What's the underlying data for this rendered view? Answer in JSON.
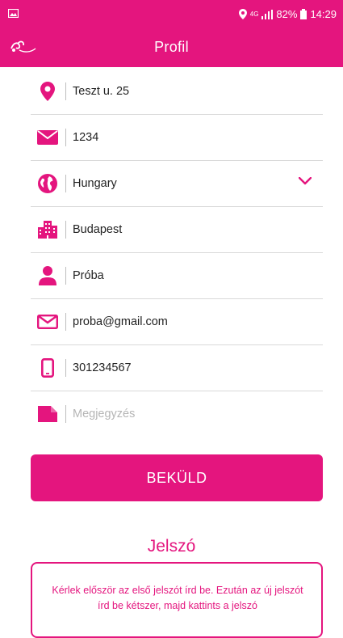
{
  "status_bar": {
    "network": "4G",
    "battery": "82%",
    "time": "14:29"
  },
  "app_bar": {
    "title": "Profil"
  },
  "form": {
    "fields": [
      {
        "icon": "location-pin-icon",
        "value": "Teszt u. 25",
        "placeholder": ""
      },
      {
        "icon": "envelope-icon",
        "value": "1234",
        "placeholder": ""
      },
      {
        "icon": "globe-icon",
        "value": "Hungary",
        "placeholder": ""
      },
      {
        "icon": "city-icon",
        "value": "Budapest",
        "placeholder": ""
      },
      {
        "icon": "person-icon",
        "value": "Próba",
        "placeholder": ""
      },
      {
        "icon": "mail-outline-icon",
        "value": "proba@gmail.com",
        "placeholder": ""
      },
      {
        "icon": "phone-icon",
        "value": "301234567",
        "placeholder": ""
      },
      {
        "icon": "note-icon",
        "value": "",
        "placeholder": "Megjegyzés"
      }
    ],
    "submit_label": "BEKÜLD"
  },
  "password_section": {
    "title": "Jelszó",
    "info_text": "Kérlek először az első jelszót írd be. Ezután az új jelszót írd be kétszer, majd kattints a jelszó"
  },
  "colors": {
    "accent": "#e4157e"
  }
}
